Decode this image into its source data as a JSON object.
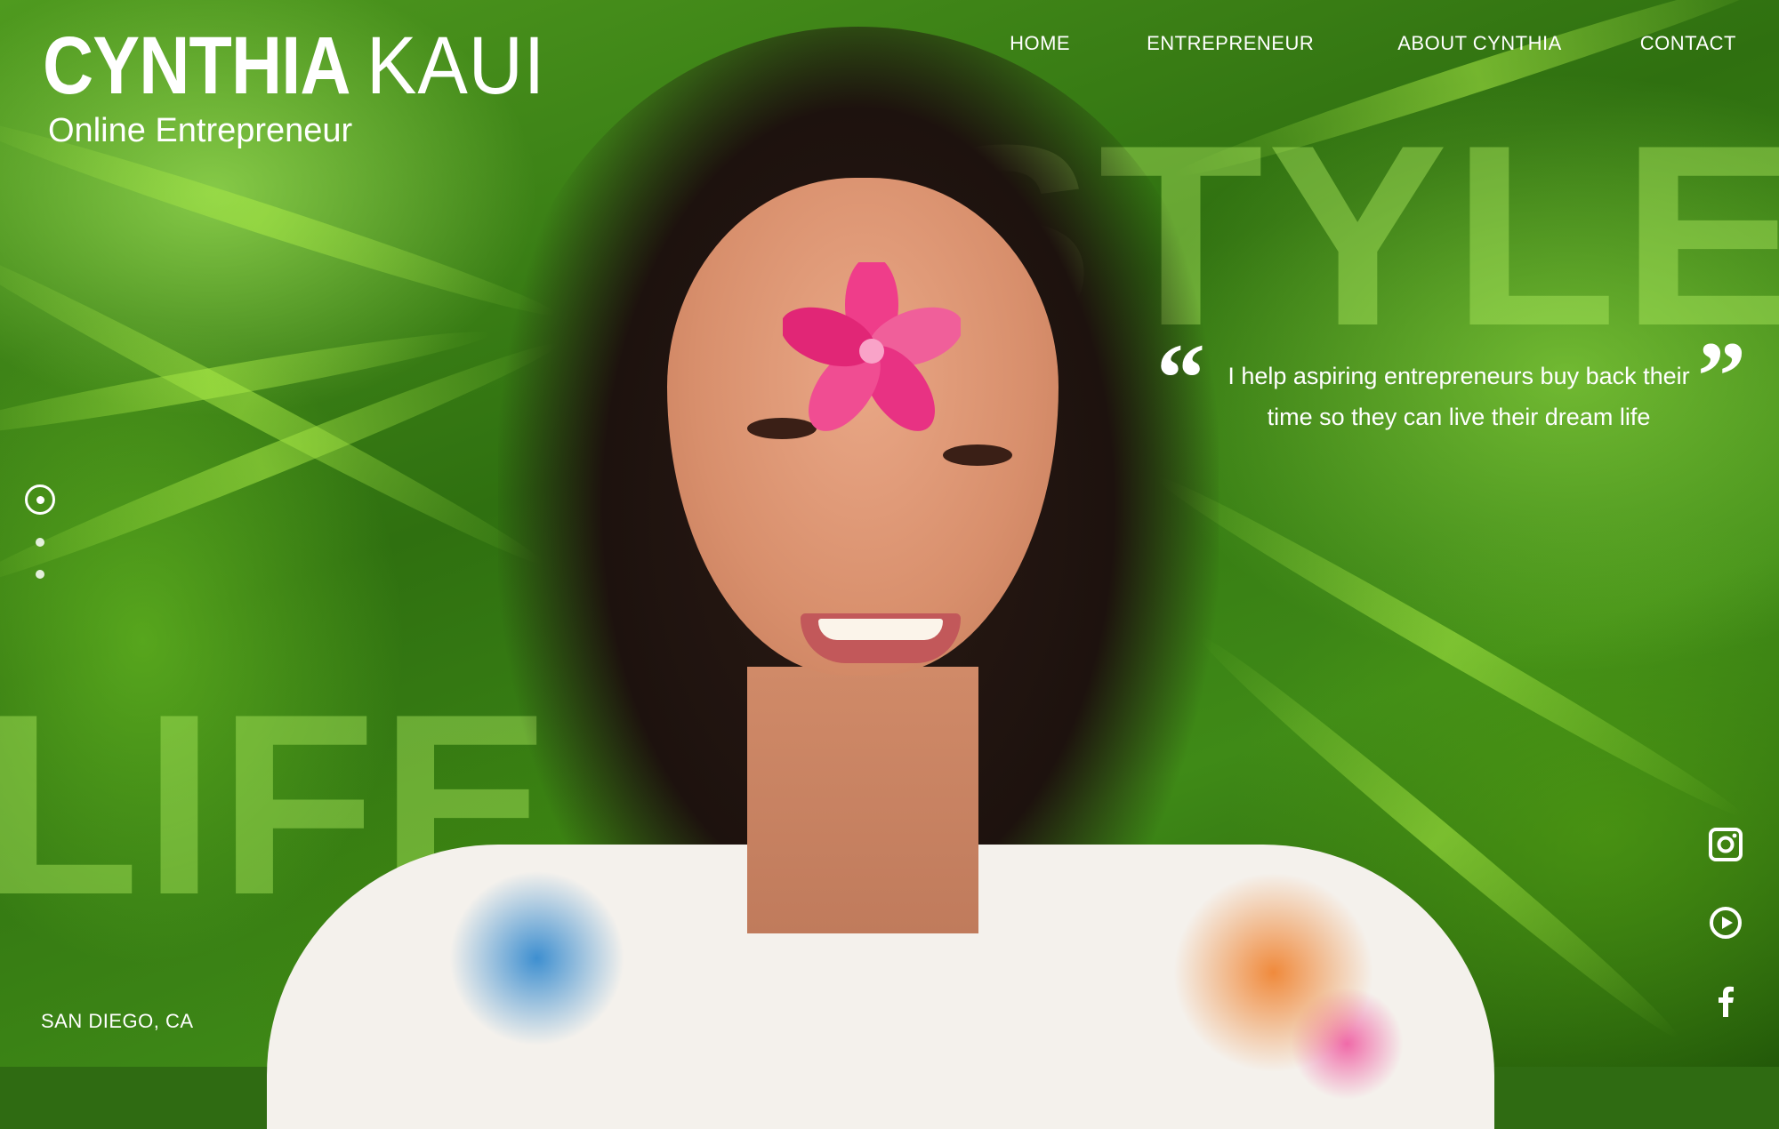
{
  "brand": {
    "first_name": "CYNTHIA",
    "last_name": "KAUI",
    "tagline": "Online Entrepreneur"
  },
  "nav": {
    "items": [
      {
        "label": "HOME"
      },
      {
        "label": "ENTREPRENEUR"
      },
      {
        "label": "ABOUT CYNTHIA"
      },
      {
        "label": "CONTACT"
      }
    ]
  },
  "hero": {
    "word_top": "STYLE",
    "word_bottom": "LIFE",
    "quote_open": "“",
    "quote_close": "”",
    "quote_text": "I help aspiring entrepreneurs buy back their time so they can live their dream life",
    "location": "SAN DIEGO, CA"
  },
  "slider": {
    "active_index": 1,
    "total": 3
  },
  "social": {
    "icons": [
      "instagram-icon",
      "youtube-icon",
      "facebook-icon"
    ]
  },
  "colors": {
    "text": "#ffffff",
    "overlay_word": "#b4f064",
    "background_green": "#3f8a17"
  }
}
